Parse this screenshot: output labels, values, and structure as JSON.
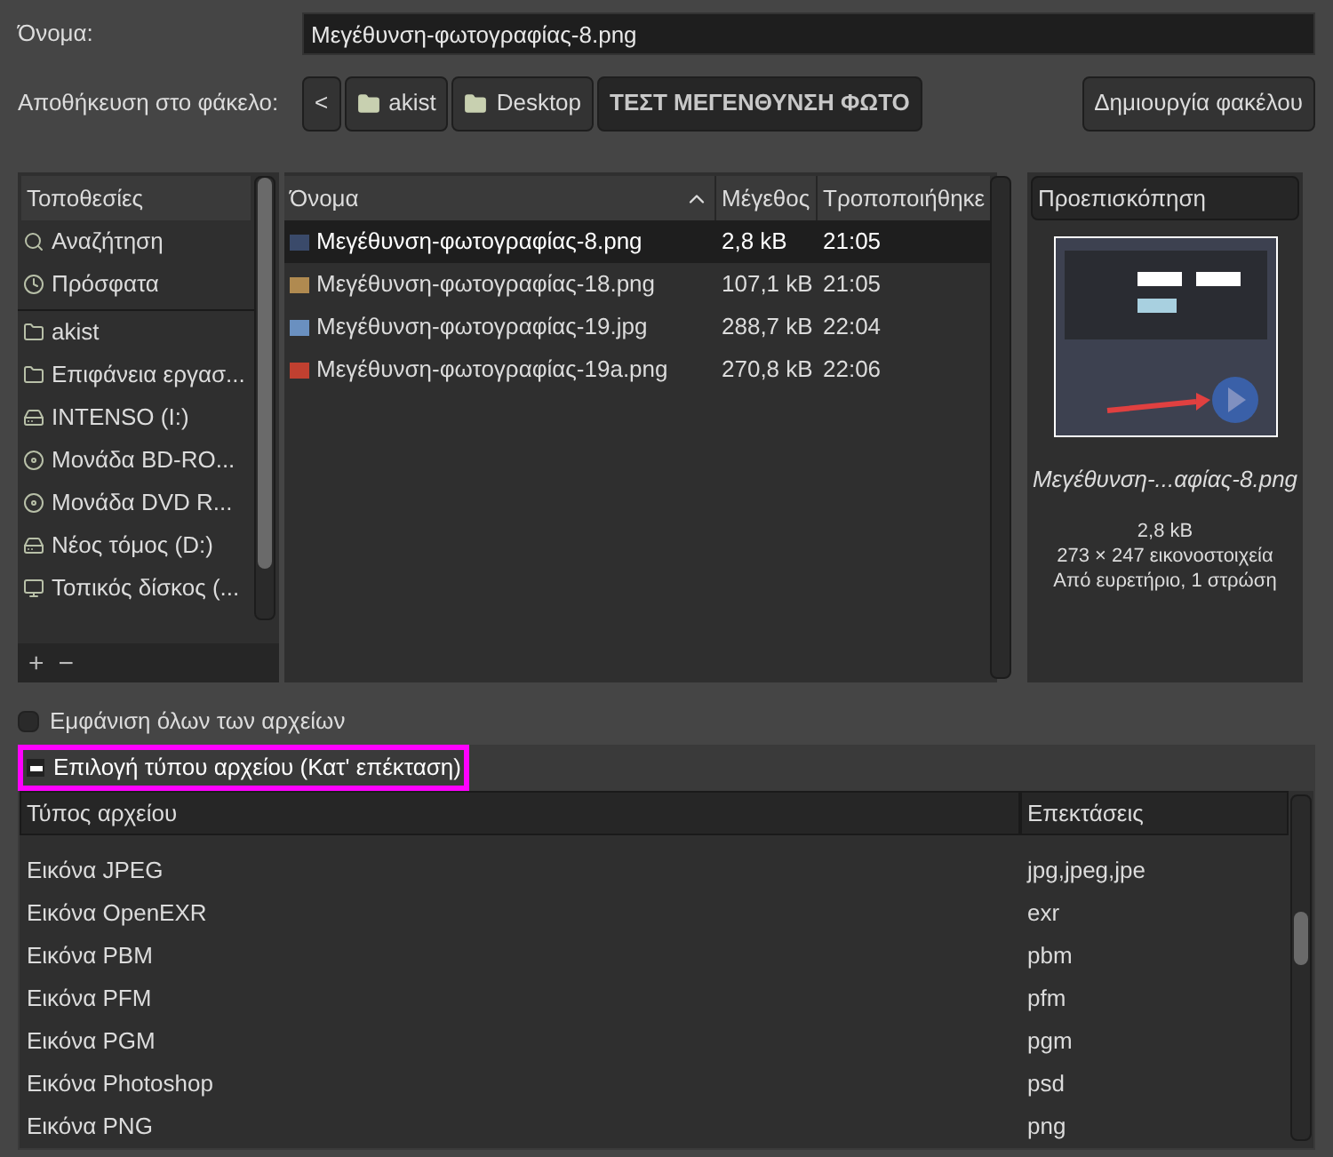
{
  "name_field": {
    "label": "Όνομα:",
    "value": "Μεγέθυνση-φωτογραφίας-8.png"
  },
  "folder_row": {
    "label": "Αποθήκευση στο φάκελο:",
    "back": "<",
    "path": [
      {
        "label": "akist",
        "kind": "folder",
        "selected": false
      },
      {
        "label": "Desktop",
        "kind": "folder",
        "selected": false
      },
      {
        "label": "ΤΕΣΤ ΜΕΓΕΝΘΥΝΣΗ ΦΩΤΟ",
        "kind": "plain",
        "selected": true
      }
    ],
    "create_button": "Δημιουργία φακέλου"
  },
  "places": {
    "header": "Τοποθεσίες",
    "sections": [
      {
        "items": [
          {
            "label": "Αναζήτηση",
            "kind": "search"
          },
          {
            "label": "Πρόσφατα",
            "kind": "recent"
          }
        ]
      },
      {
        "items": [
          {
            "label": "akist",
            "kind": "folder"
          },
          {
            "label": "Επιφάνεια εργασ...",
            "kind": "folder"
          },
          {
            "label": "INTENSO (I:)",
            "kind": "drive"
          },
          {
            "label": "Μονάδα BD-RO...",
            "kind": "optical"
          },
          {
            "label": "Μονάδα DVD R...",
            "kind": "optical"
          },
          {
            "label": "Νέος τόμος (D:)",
            "kind": "drive"
          },
          {
            "label": "Τοπικός δίσκος (...",
            "kind": "system"
          }
        ]
      }
    ],
    "add": "+",
    "remove": "−"
  },
  "files": {
    "columns": [
      "Όνομα",
      "Μέγεθος",
      "Τροποποιήθηκε"
    ],
    "rows": [
      {
        "name": "Μεγέθυνση-φωτογραφίας-8.png",
        "size": "2,8 kB",
        "modified": "21:05",
        "selected": true,
        "color": "#3a4a6a"
      },
      {
        "name": "Μεγέθυνση-φωτογραφίας-18.png",
        "size": "107,1 kB",
        "modified": "21:05",
        "selected": false,
        "color": "#b08a50"
      },
      {
        "name": "Μεγέθυνση-φωτογραφίας-19.jpg",
        "size": "288,7 kB",
        "modified": "22:04",
        "selected": false,
        "color": "#6a90c0"
      },
      {
        "name": "Μεγέθυνση-φωτογραφίας-19a.png",
        "size": "270,8 kB",
        "modified": "22:06",
        "selected": false,
        "color": "#c04030"
      }
    ]
  },
  "preview": {
    "header": "Προεπισκόπηση",
    "filename": "Μεγέθυνση-...αφίας-8.png",
    "info": [
      "2,8 kB",
      "273 × 247 εικονοστοιχεία",
      "Από ευρετήριο, 1 στρώση"
    ]
  },
  "show_all": {
    "label": "Εμφάνιση όλων των αρχείων",
    "checked": false
  },
  "file_type": {
    "label": "Επιλογή τύπου αρχείου (Κατ' επέκταση)",
    "expanded": true,
    "columns": [
      "Τύπος αρχείου",
      "Επεκτάσεις"
    ],
    "rows": [
      {
        "type": "Εικόνα JPEG",
        "ext": "jpg,jpeg,jpe"
      },
      {
        "type": "Εικόνα OpenEXR",
        "ext": "exr"
      },
      {
        "type": "Εικόνα PBM",
        "ext": "pbm"
      },
      {
        "type": "Εικόνα PFM",
        "ext": "pfm"
      },
      {
        "type": "Εικόνα PGM",
        "ext": "pgm"
      },
      {
        "type": "Εικόνα Photoshop",
        "ext": "psd"
      },
      {
        "type": "Εικόνα PNG",
        "ext": "png"
      }
    ]
  }
}
